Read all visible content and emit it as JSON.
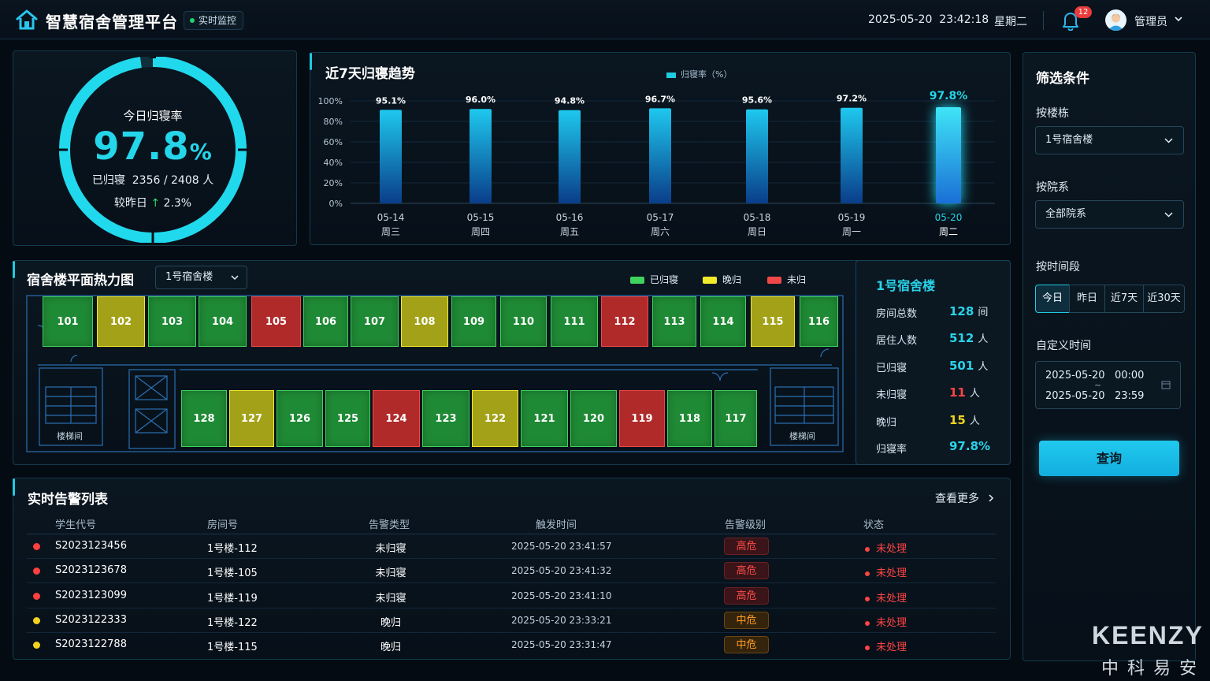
{
  "header": {
    "title": "智慧宿舍管理平台",
    "live_badge": "实时监控",
    "datetime": "2025-05-20  23:42:18",
    "weekday": "星期二",
    "notifications": "12",
    "user": "管理员"
  },
  "rate_card": {
    "label": "今日归寝率",
    "value": "97.8",
    "unit": "%",
    "returned_text": "已归寝  2356 / 2408 人",
    "compare_label": "较昨日",
    "compare_arrow": "↑",
    "compare_value": "2.3%",
    "progress": 0.978
  },
  "trend": {
    "title": "近7天归寝趋势",
    "legend": "归寝率（%）"
  },
  "chart_data": {
    "type": "bar",
    "title": "近7天归寝趋势",
    "categories": [
      "05-14",
      "05-15",
      "05-16",
      "05-17",
      "05-18",
      "05-19",
      "05-20"
    ],
    "weekdays": [
      "周三",
      "周四",
      "周五",
      "周六",
      "周日",
      "周一",
      "周二"
    ],
    "series": [
      {
        "name": "归寝率（%）",
        "values": [
          95.1,
          96.0,
          94.8,
          96.7,
          95.6,
          97.2,
          97.8
        ]
      }
    ],
    "value_labels": [
      "95.1%",
      "96.0%",
      "94.8%",
      "96.7%",
      "95.6%",
      "97.2%",
      "97.8%"
    ],
    "y_ticks": [
      "100%",
      "80%",
      "60%",
      "40%",
      "20%",
      "0%"
    ],
    "ylim": [
      0,
      100
    ],
    "highlight_index": 6,
    "legend_position": "top-center",
    "grid": true
  },
  "heatmap": {
    "title": "宿舍楼平面热力图",
    "building_select": "1号宿舍楼",
    "legend": [
      {
        "label": "已归寝",
        "color": "#3fd35d"
      },
      {
        "label": "晚归",
        "color": "#f1ea2a"
      },
      {
        "label": "未归",
        "color": "#f04848"
      }
    ],
    "top_rooms": [
      {
        "no": "101",
        "status": "green"
      },
      {
        "no": "102",
        "status": "yellow"
      },
      {
        "no": "103",
        "status": "green"
      },
      {
        "no": "104",
        "status": "green"
      },
      {
        "no": "105",
        "status": "red"
      },
      {
        "no": "106",
        "status": "green"
      },
      {
        "no": "107",
        "status": "green"
      },
      {
        "no": "108",
        "status": "yellow"
      },
      {
        "no": "109",
        "status": "green"
      },
      {
        "no": "110",
        "status": "green"
      },
      {
        "no": "111",
        "status": "green"
      },
      {
        "no": "112",
        "status": "red"
      },
      {
        "no": "113",
        "status": "green"
      },
      {
        "no": "114",
        "status": "green"
      },
      {
        "no": "115",
        "status": "yellow"
      },
      {
        "no": "116",
        "status": "green"
      }
    ],
    "bottom_rooms": [
      {
        "no": "128",
        "status": "green"
      },
      {
        "no": "127",
        "status": "yellow"
      },
      {
        "no": "126",
        "status": "green"
      },
      {
        "no": "125",
        "status": "green"
      },
      {
        "no": "124",
        "status": "red"
      },
      {
        "no": "123",
        "status": "green"
      },
      {
        "no": "122",
        "status": "yellow"
      },
      {
        "no": "121",
        "status": "green"
      },
      {
        "no": "120",
        "status": "green"
      },
      {
        "no": "119",
        "status": "red"
      },
      {
        "no": "118",
        "status": "green"
      },
      {
        "no": "117",
        "status": "green"
      }
    ],
    "stair_left": "楼梯间",
    "stair_right": "楼梯间"
  },
  "building_stats": {
    "title": "1号宿舍楼",
    "rows": [
      {
        "label": "房间总数",
        "value": "128",
        "unit": "间",
        "color": "#29d3ea"
      },
      {
        "label": "居住人数",
        "value": "512",
        "unit": "人",
        "color": "#29d3ea"
      },
      {
        "label": "已归寝",
        "value": "501",
        "unit": "人",
        "color": "#29d3ea"
      },
      {
        "label": "未归寝",
        "value": "11",
        "unit": "人",
        "color": "#ff4444"
      },
      {
        "label": "晚归",
        "value": "15",
        "unit": "人",
        "color": "#f2d21e"
      },
      {
        "label": "归寝率",
        "value": "97.8%",
        "unit": "",
        "color": "#29d3ea"
      }
    ]
  },
  "alerts": {
    "title": "实时告警列表",
    "see_more": "查看更多",
    "columns": [
      "学生代号",
      "房间号",
      "告警类型",
      "触发时间",
      "告警级别",
      "状态"
    ],
    "rows": [
      {
        "id": "S2023123456",
        "room": "1号楼-112",
        "type": "未归寝",
        "time": "2025-05-20 23:41:57",
        "level": "高危",
        "level_kind": "high",
        "status": "未处理",
        "dot_color": "#ff4040"
      },
      {
        "id": "S2023123678",
        "room": "1号楼-105",
        "type": "未归寝",
        "time": "2025-05-20 23:41:32",
        "level": "高危",
        "level_kind": "high",
        "status": "未处理",
        "dot_color": "#ff4040"
      },
      {
        "id": "S2023123099",
        "room": "1号楼-119",
        "type": "未归寝",
        "time": "2025-05-20 23:41:10",
        "level": "高危",
        "level_kind": "high",
        "status": "未处理",
        "dot_color": "#ff4040"
      },
      {
        "id": "S2023122333",
        "room": "1号楼-122",
        "type": "晚归",
        "time": "2025-05-20 23:33:21",
        "level": "中危",
        "level_kind": "mid",
        "status": "未处理",
        "dot_color": "#f2d21e"
      },
      {
        "id": "S2023122788",
        "room": "1号楼-115",
        "type": "晚归",
        "time": "2025-05-20 23:31:47",
        "level": "中危",
        "level_kind": "mid",
        "status": "未处理",
        "dot_color": "#f2d21e"
      }
    ]
  },
  "filters": {
    "title": "筛选条件",
    "building_label": "按楼栋",
    "building_value": "1号宿舍楼",
    "dept_label": "按院系",
    "dept_value": "全部院系",
    "period_label": "按时间段",
    "periods": [
      "今日",
      "昨日",
      "近7天",
      "近30天"
    ],
    "active_period": 0,
    "custom_label": "自定义时间",
    "date_start": "2025-05-20   00:00",
    "date_sep": "~",
    "date_end": "2025-05-20   23:59",
    "query_button": "查询"
  },
  "watermark": {
    "brand_en": "KEENZY",
    "brand_cn": "中科易安"
  }
}
